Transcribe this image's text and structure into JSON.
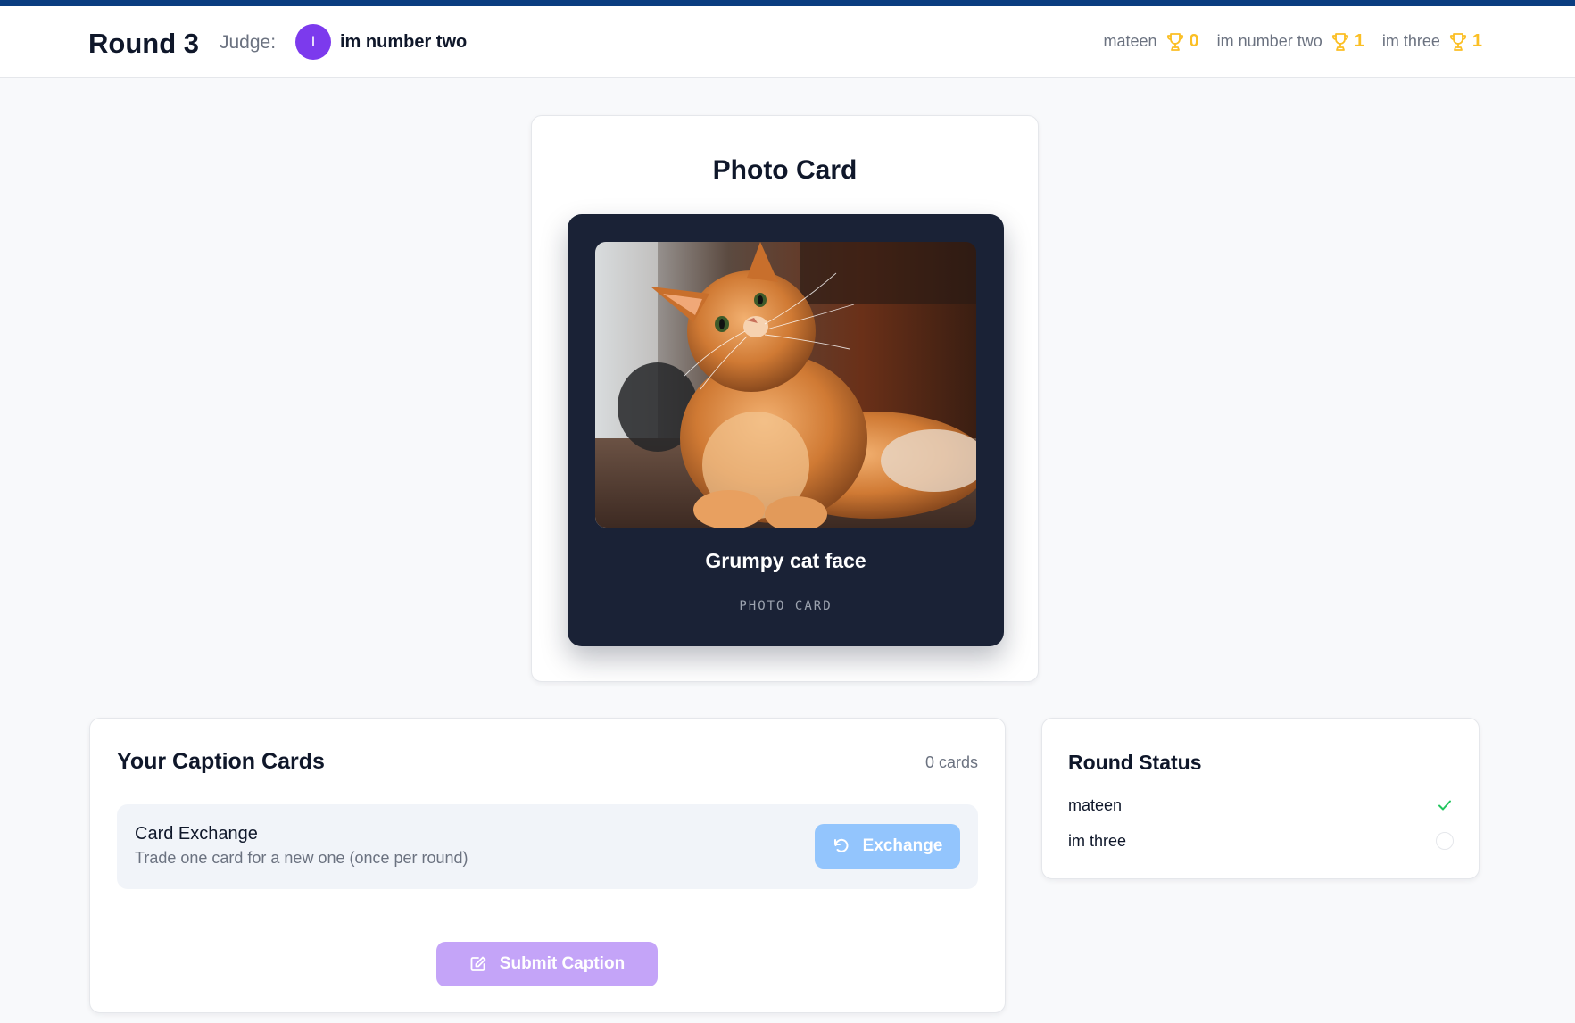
{
  "header": {
    "round_label": "Round 3",
    "judge_label": "Judge:",
    "judge": {
      "initial": "I",
      "name": "im number two",
      "avatar_color": "#7c3aed"
    },
    "scores": [
      {
        "name": "mateen",
        "score": "0"
      },
      {
        "name": "im number two",
        "score": "1"
      },
      {
        "name": "im three",
        "score": "1"
      }
    ]
  },
  "photo_panel": {
    "title": "Photo Card",
    "card": {
      "caption": "Grumpy cat face",
      "type_label": "PHOTO CARD",
      "image_subject": "orange-tabby-cat-photo"
    }
  },
  "caption_panel": {
    "title": "Your Caption Cards",
    "count": "0 cards",
    "exchange": {
      "title": "Card Exchange",
      "description": "Trade one card for a new one (once per round)",
      "button_label": "Exchange",
      "button_icon": "refresh-icon"
    },
    "submit_label": "Submit Caption",
    "submit_icon": "edit-icon"
  },
  "status_panel": {
    "title": "Round Status",
    "players": [
      {
        "name": "mateen",
        "status": "submitted"
      },
      {
        "name": "im three",
        "status": "pending"
      }
    ]
  },
  "colors": {
    "accent_bar": "#0b3d80",
    "trophy": "#fbbf24",
    "exchange_button": "#93c5fd",
    "submit_button": "#c4a4f8",
    "check": "#22c55e",
    "card_bg": "#1a2236"
  }
}
